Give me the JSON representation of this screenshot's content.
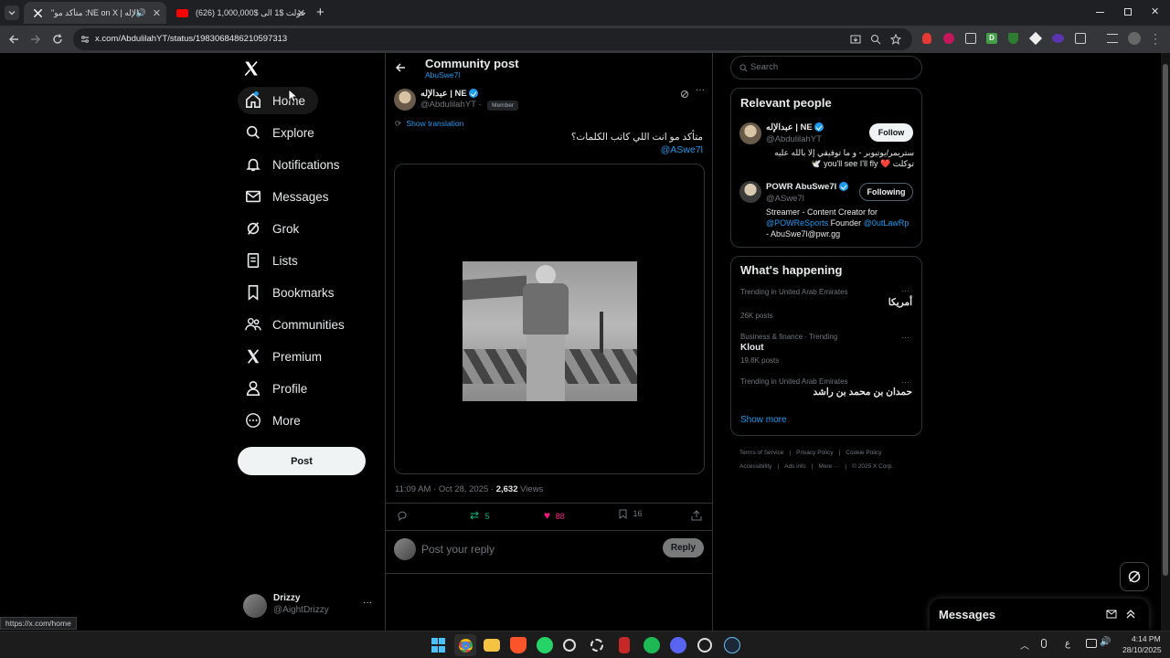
{
  "browser": {
    "tabs": [
      {
        "title": "\"متأكد مو :NE on X | عبدالإله",
        "active": true
      },
      {
        "title": "(626) حولت $1 الى $1,000,000",
        "active": false
      }
    ],
    "new_tab": "+",
    "url": "x.com/AbdulilahYT/status/1983068486210597313",
    "status_url": "https://x.com/home"
  },
  "nav": {
    "items": [
      {
        "label": "Home",
        "icon": "home-icon"
      },
      {
        "label": "Explore",
        "icon": "search-icon"
      },
      {
        "label": "Notifications",
        "icon": "bell-icon"
      },
      {
        "label": "Messages",
        "icon": "envelope-icon"
      },
      {
        "label": "Grok",
        "icon": "grok-icon"
      },
      {
        "label": "Lists",
        "icon": "list-icon"
      },
      {
        "label": "Bookmarks",
        "icon": "bookmark-icon"
      },
      {
        "label": "Communities",
        "icon": "people-icon"
      },
      {
        "label": "Premium",
        "icon": "x-logo-icon"
      },
      {
        "label": "Profile",
        "icon": "person-icon"
      },
      {
        "label": "More",
        "icon": "more-circle-icon"
      }
    ],
    "post_button": "Post",
    "account": {
      "name": "Drizzy",
      "handle": "@AightDrizzy",
      "more": "···"
    }
  },
  "header": {
    "title": "Community post",
    "subtitle": "AbuSwe7l"
  },
  "post": {
    "author_name": "عبدالإله | NE",
    "author_handle": "@AbdulilahYT",
    "separator": "·",
    "badge": "Member",
    "show_translation": "Show translation",
    "text": "متأكد مو انت اللي كاتب الكلمات؟",
    "mention": "@ASwe7l",
    "time": "11:09 AM · Oct 28, 2025 · ",
    "views_count": "2,632",
    "views_label": " Views",
    "actions": {
      "reposts": "5",
      "likes": "88",
      "bookmarks": "16"
    },
    "reply_placeholder": "Post your reply",
    "reply_button": "Reply"
  },
  "right": {
    "search_placeholder": "Search",
    "relevant_title": "Relevant people",
    "people": [
      {
        "name": "عبدالإله | NE",
        "handle": "@AbdulilahYT",
        "button": "Follow",
        "bio": "ستريمر/يوتيوبر - و ما توفيقي إلا بالله عليه توكلت ❤️ you'll see I'll fly 🕊️"
      },
      {
        "name": "POWR AbuSwe7l",
        "handle": "@ASwe7l",
        "button": "Following",
        "bio_line1": "Streamer - Content Creator for",
        "bio_link1": "@POWReSports",
        "bio_mid": " Founder ",
        "bio_link2": "@0utLawRp",
        "bio_line3": "- AbuSwe7l@pwr.gg"
      }
    ],
    "happening_title": "What's happening",
    "trends": [
      {
        "context": "Trending in United Arab Emirates",
        "title": "أمريكا",
        "posts": "26K posts"
      },
      {
        "context": "Business & finance · Trending",
        "title": "Klout",
        "posts": "19.8K posts"
      },
      {
        "context": "Trending in United Arab Emirates",
        "title": "حمدان بن محمد بن راشد",
        "posts": ""
      }
    ],
    "trend_more": "···",
    "show_more": "Show more",
    "footer_line1": [
      "Terms of Service",
      "Privacy Policy",
      "Cookie Policy"
    ],
    "footer_line2": [
      "Accessibility",
      "Ads info",
      "More ···",
      "© 2025 X Corp."
    ],
    "footer_sep": "|"
  },
  "messages_dock": {
    "label": "Messages"
  },
  "taskbar": {
    "lang": "ع",
    "time": "4:14 PM",
    "date": "28/10/2025"
  },
  "colors": {
    "accent": "#1d9bf0",
    "like": "#f91880",
    "repost": "#00ba7c"
  }
}
